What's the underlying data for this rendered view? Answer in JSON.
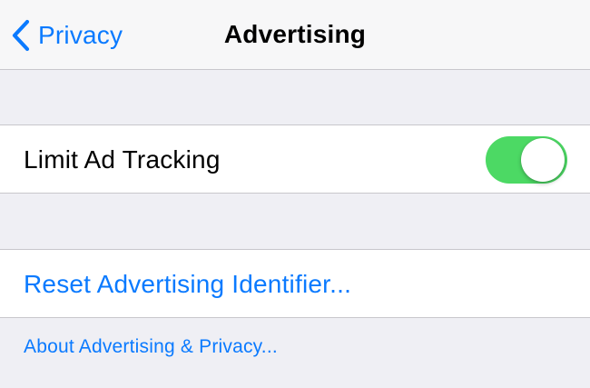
{
  "navbar": {
    "back_label": "Privacy",
    "title": "Advertising"
  },
  "settings": {
    "limit_ad_tracking": {
      "label": "Limit Ad Tracking",
      "enabled": true
    },
    "reset_identifier_label": "Reset Advertising Identifier..."
  },
  "footer": {
    "about_link": "About Advertising & Privacy..."
  },
  "colors": {
    "accent": "#0a7aff",
    "toggle_on": "#4cd964",
    "background": "#efeff4"
  }
}
